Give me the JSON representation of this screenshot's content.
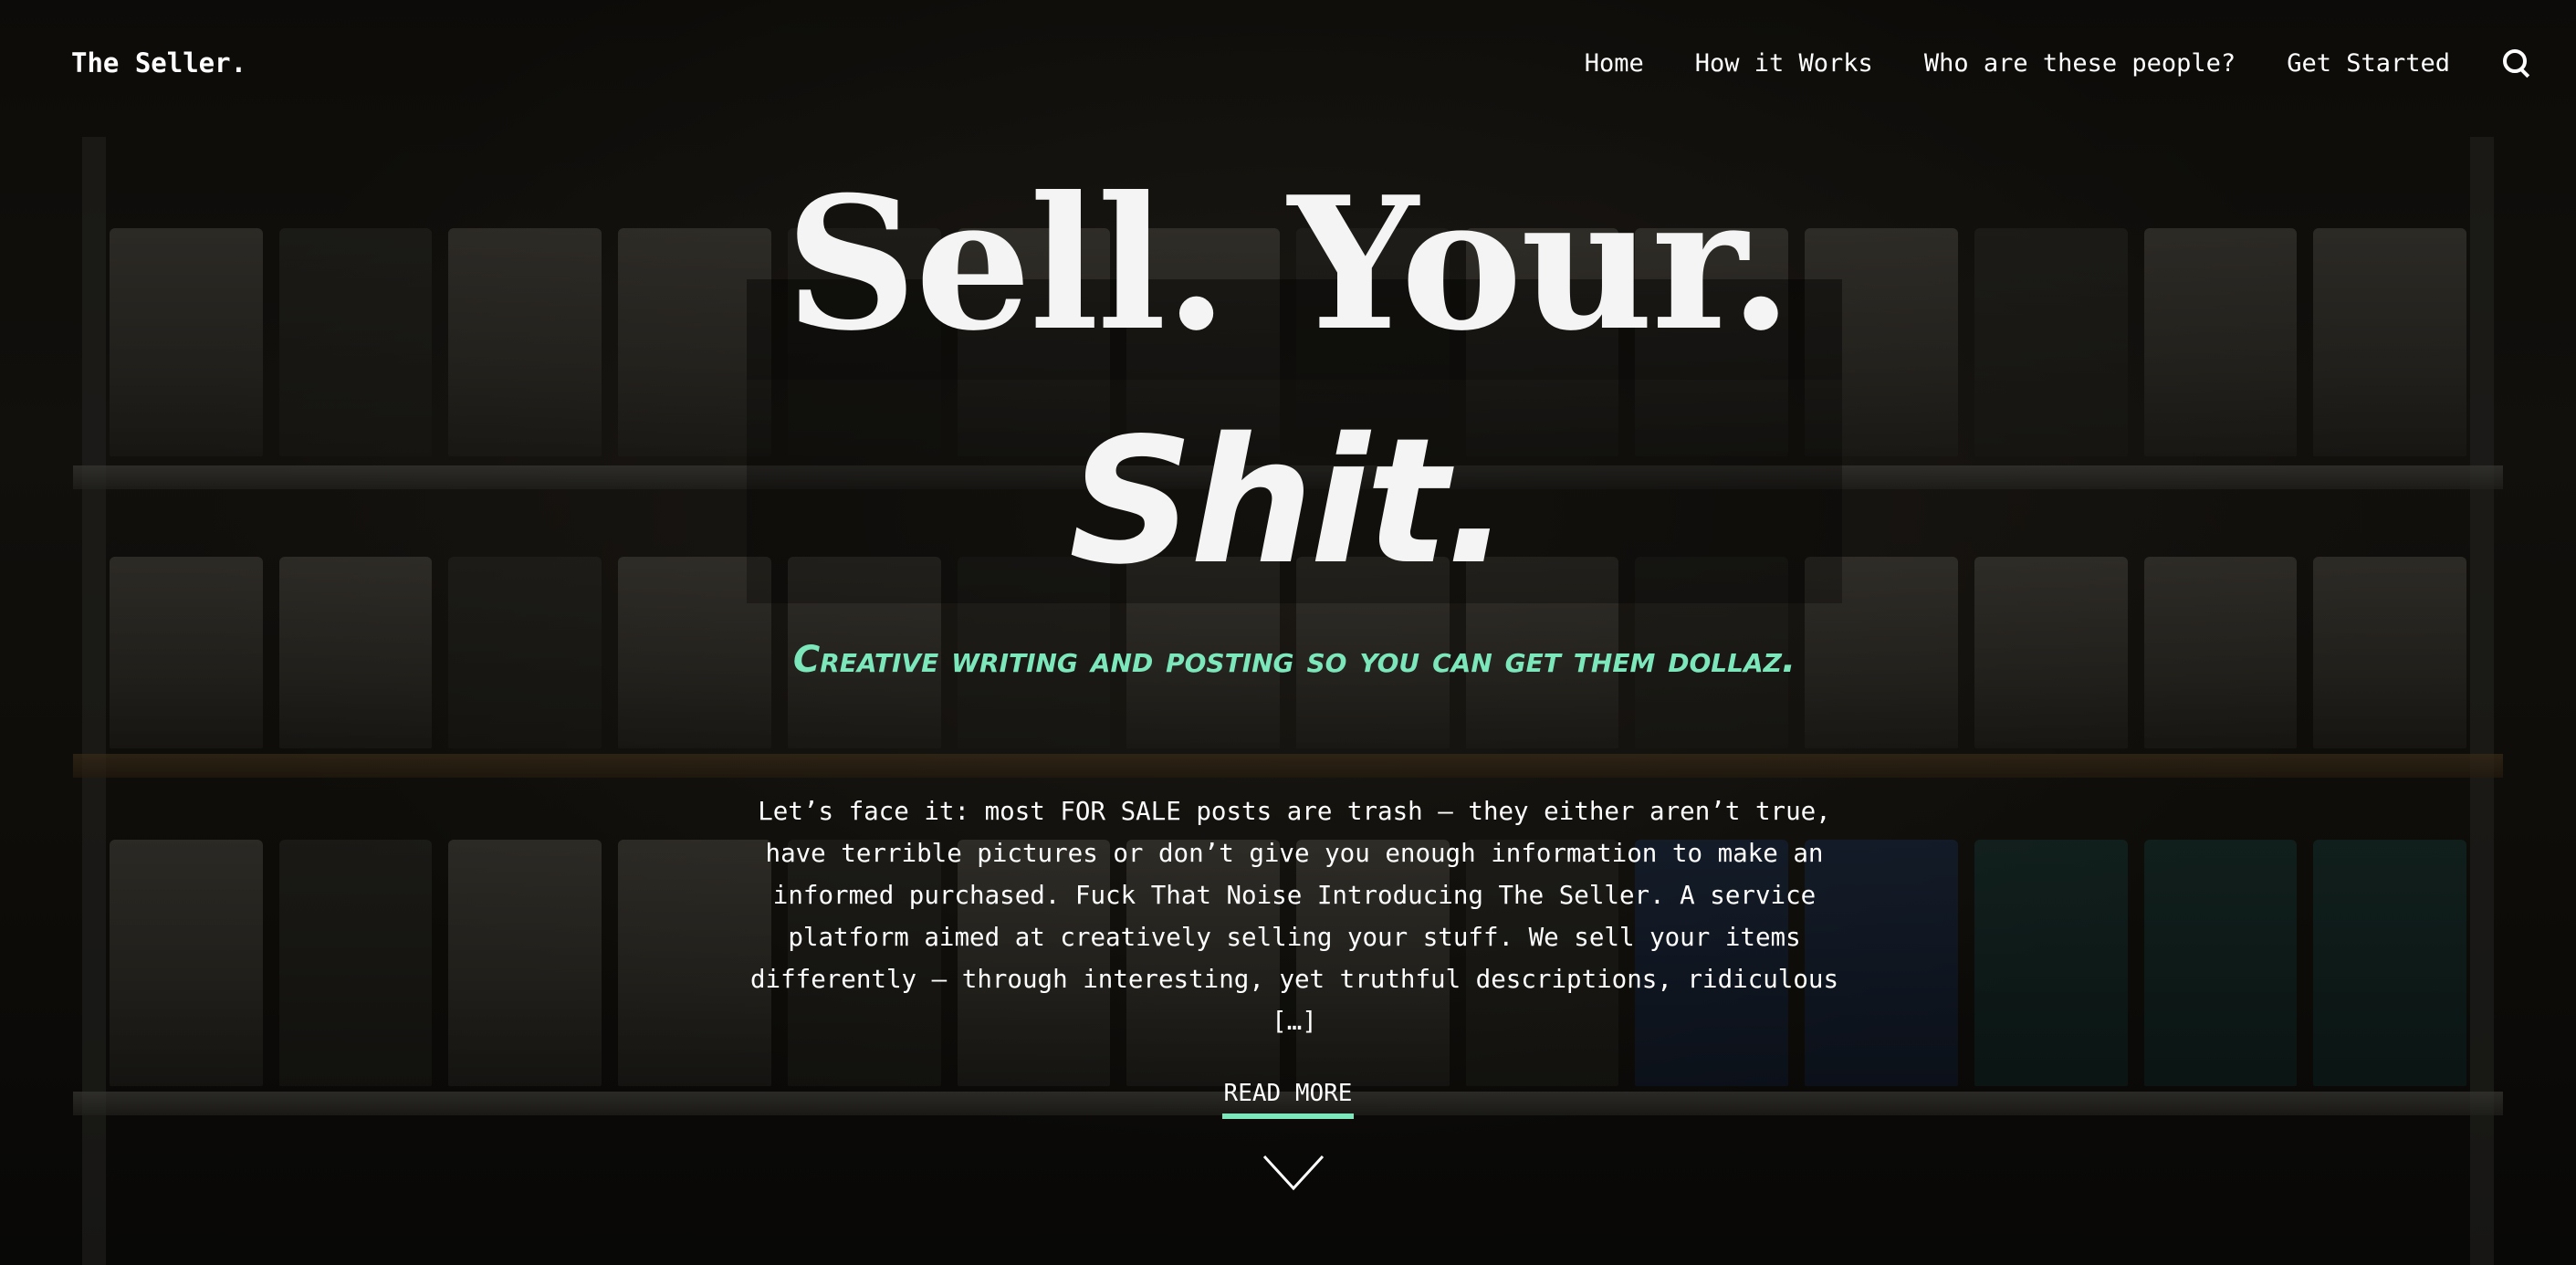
{
  "header": {
    "site_title": "The Seller.",
    "nav": [
      {
        "label": "Home"
      },
      {
        "label": "How it Works"
      },
      {
        "label": "Who are these people?"
      },
      {
        "label": "Get Started"
      }
    ],
    "search_icon": "search-icon"
  },
  "hero": {
    "title_line1": "Sell. Your.",
    "title_line2": "Shit.",
    "tagline": "Creative writing and posting so you can get them dollaz.",
    "excerpt": "Let’s face it: most FOR SALE posts are trash – they either aren’t true, have terrible pictures or don’t give you enough information to make an informed purchased. Fuck That Noise Introducing The Seller. A service platform aimed at creatively selling your stuff. We sell your items differently – through interesting, yet truthful descriptions, ridiculous […]",
    "read_more": "READ MORE",
    "scroll_icon": "chevron-down-icon"
  },
  "colors": {
    "accent": "#7de7bc",
    "text": "#ffffff",
    "overlay": "rgba(0,0,0,0.38)"
  }
}
